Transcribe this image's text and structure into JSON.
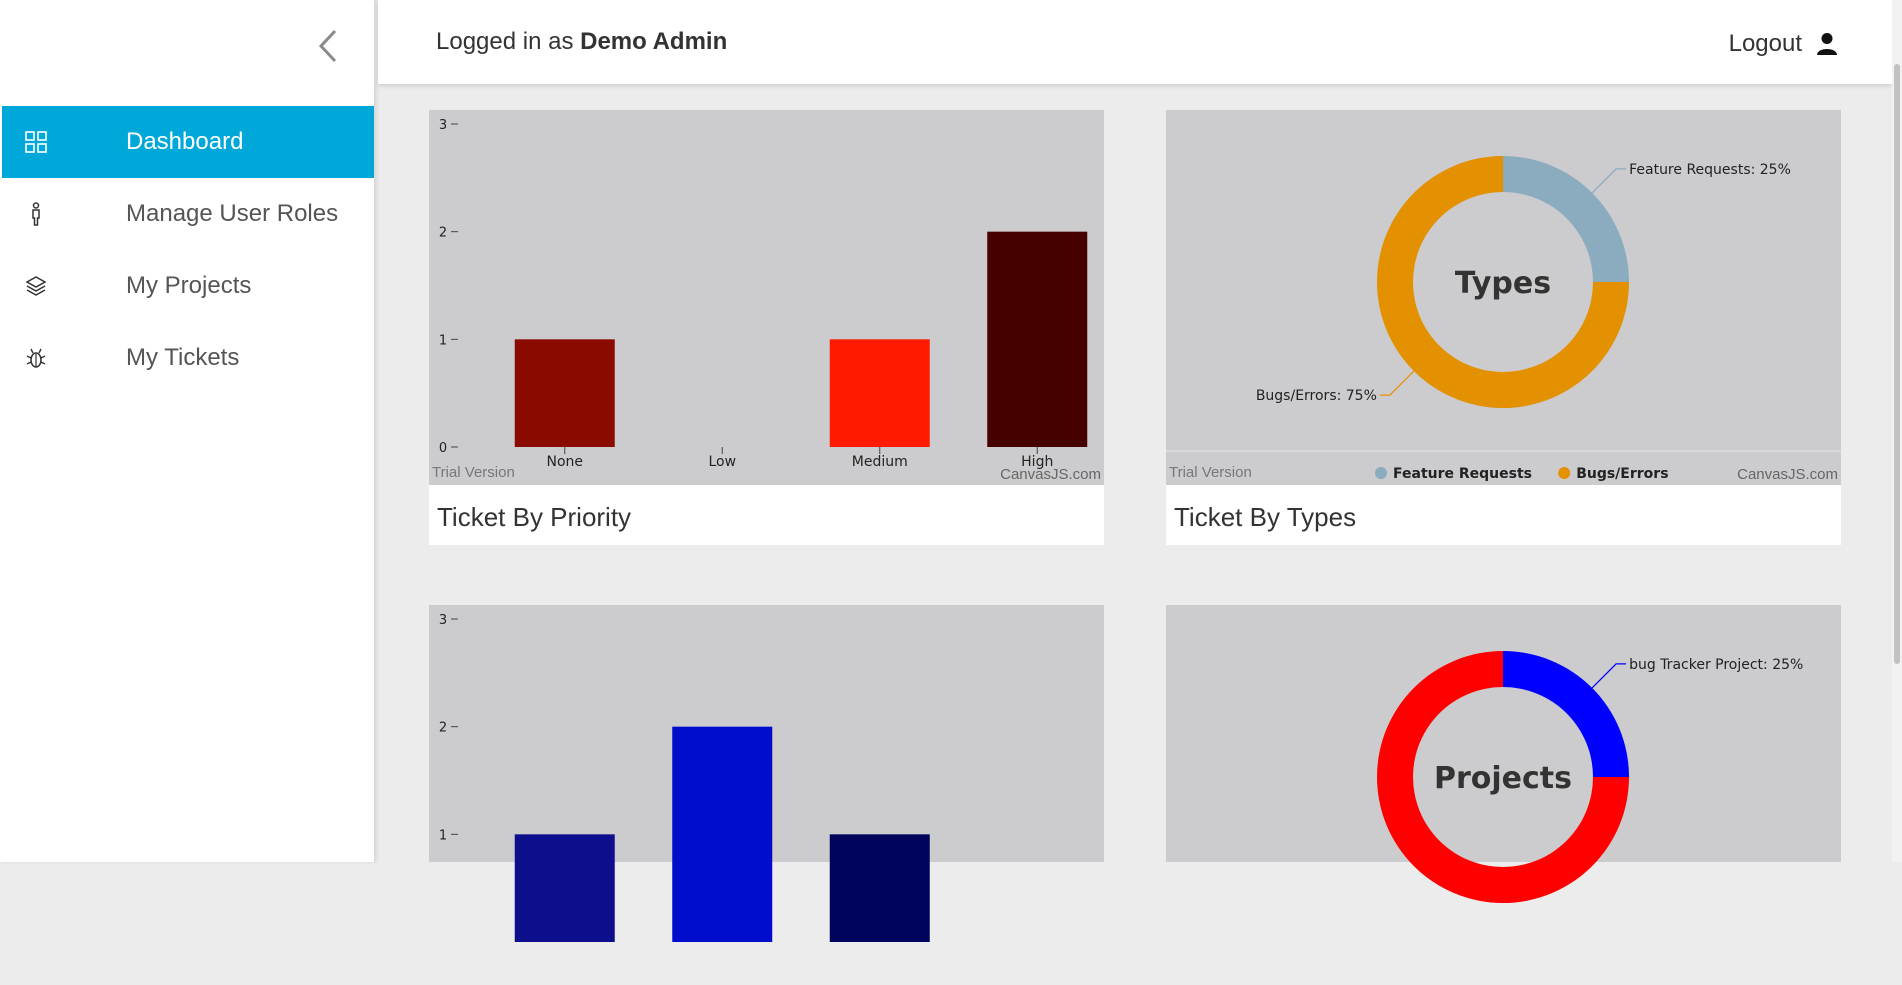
{
  "sidebar": {
    "items": [
      {
        "label": "Dashboard",
        "icon": "grid-icon",
        "active": true
      },
      {
        "label": "Manage User Roles",
        "icon": "person-icon",
        "active": false
      },
      {
        "label": "My Projects",
        "icon": "layers-icon",
        "active": false
      },
      {
        "label": "My Tickets",
        "icon": "bug-icon",
        "active": false
      }
    ]
  },
  "header": {
    "logged_prefix": "Logged in as",
    "user_name": "Demo Admin",
    "logout_label": "Logout"
  },
  "colors": {
    "accent": "#00a8d9",
    "chart_bg": "#cccbce"
  },
  "cards": [
    {
      "title": "Ticket By Priority",
      "trial": "Trial Version",
      "credit": "CanvasJS.com"
    },
    {
      "title": "Ticket By Types",
      "trial": "Trial Version",
      "credit": "CanvasJS.com"
    }
  ],
  "chart_data": [
    {
      "type": "bar",
      "categories": [
        "None",
        "Low",
        "Medium",
        "High"
      ],
      "values": [
        1,
        0,
        1,
        2
      ],
      "colors": [
        "#8b0a00",
        "#cc0000",
        "#ff1a00",
        "#470000"
      ],
      "yticks": [
        0,
        1,
        2,
        3
      ],
      "ylim": [
        0,
        3
      ]
    },
    {
      "type": "pie",
      "center_label": "Types",
      "slices": [
        {
          "name": "Feature Requests",
          "value": 25,
          "label": "Feature Requests: 25%",
          "color": "#8aacbe"
        },
        {
          "name": "Bugs/Errors",
          "value": 75,
          "label": "Bugs/Errors: 75%",
          "color": "#e39100"
        }
      ],
      "legend": [
        "Feature Requests",
        "Bugs/Errors"
      ],
      "legend_position": "bottom"
    },
    {
      "type": "bar",
      "values": [
        1,
        2,
        1
      ],
      "colors": [
        "#0d0e8b",
        "#000ccc",
        "#00035c"
      ],
      "yticks": [
        1,
        2,
        3
      ],
      "ylim": [
        0,
        3
      ]
    },
    {
      "type": "pie",
      "center_label": "Projects",
      "slices": [
        {
          "name": "bug Tracker Project",
          "value": 25,
          "label": "bug Tracker Project: 25%",
          "color": "#0000ff"
        },
        {
          "name": "",
          "value": 75,
          "label": "",
          "color": "#ff0000"
        }
      ]
    }
  ]
}
